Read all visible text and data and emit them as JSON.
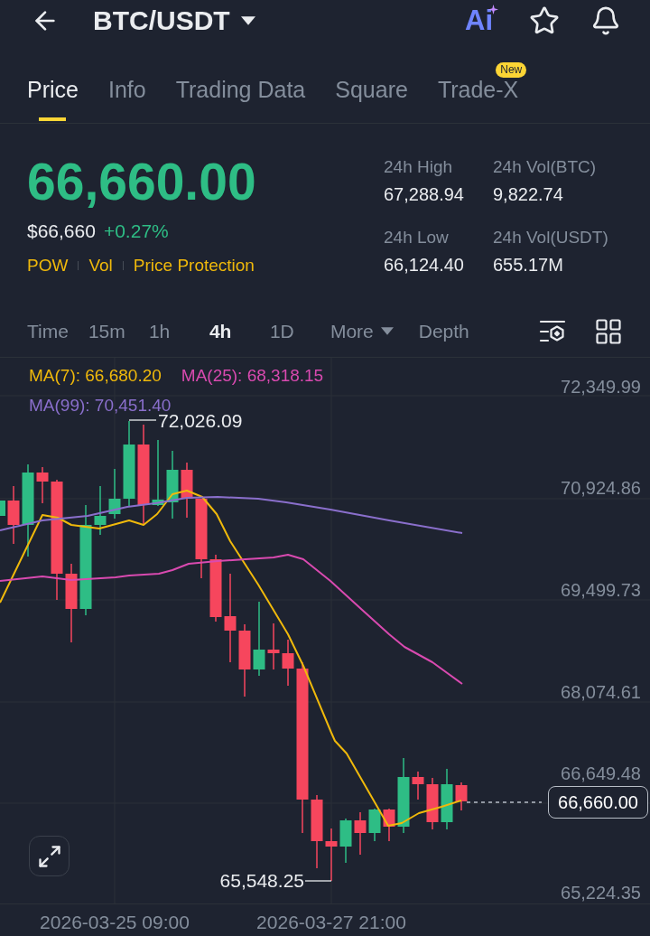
{
  "header": {
    "title": "BTC/USDT",
    "ai_label": "Ai"
  },
  "tabs": [
    {
      "label": "Price",
      "selected": true
    },
    {
      "label": "Info",
      "selected": false
    },
    {
      "label": "Trading Data",
      "selected": false
    },
    {
      "label": "Square",
      "selected": false
    },
    {
      "label": "Trade-X",
      "selected": false,
      "badge": "New"
    }
  ],
  "price": {
    "last": "66,660.00",
    "fiat": "$66,660",
    "change": "+0.27%",
    "tags": [
      "POW",
      "Vol",
      "Price Protection"
    ]
  },
  "stats": [
    {
      "label": "24h High",
      "value": "67,288.94"
    },
    {
      "label": "24h Vol(BTC)",
      "value": "9,822.74"
    },
    {
      "label": "24h Low",
      "value": "66,124.40"
    },
    {
      "label": "24h Vol(USDT)",
      "value": "655.17M"
    }
  ],
  "intervals": [
    {
      "label": "Time",
      "kind": "option",
      "selected": false
    },
    {
      "label": "15m",
      "kind": "option",
      "selected": false
    },
    {
      "label": "1h",
      "kind": "option",
      "selected": false
    },
    {
      "label": "4h",
      "kind": "option",
      "selected": true
    },
    {
      "label": "1D",
      "kind": "option",
      "selected": false
    },
    {
      "label": "More",
      "kind": "dropdown",
      "selected": false
    },
    {
      "label": "Depth",
      "kind": "option",
      "selected": false
    }
  ],
  "chart": {
    "ma_legend": [
      {
        "label": "MA(7): 66,680.20",
        "color": "#f0b90b"
      },
      {
        "label": "MA(25): 68,318.15",
        "color": "#d94ab0"
      },
      {
        "label": "MA(99): 70,451.40",
        "color": "#8a6fcc"
      }
    ],
    "price_axis": [
      "72,349.99",
      "70,924.86",
      "69,499.73",
      "68,074.61",
      "66,649.48",
      "65,224.35"
    ],
    "high_label": "72,026.09",
    "low_label": "65,548.25",
    "last_price_tag": "66,660.00",
    "time_axis": [
      "2026-03-25 09:00",
      "2026-03-27 21:00"
    ]
  }
}
